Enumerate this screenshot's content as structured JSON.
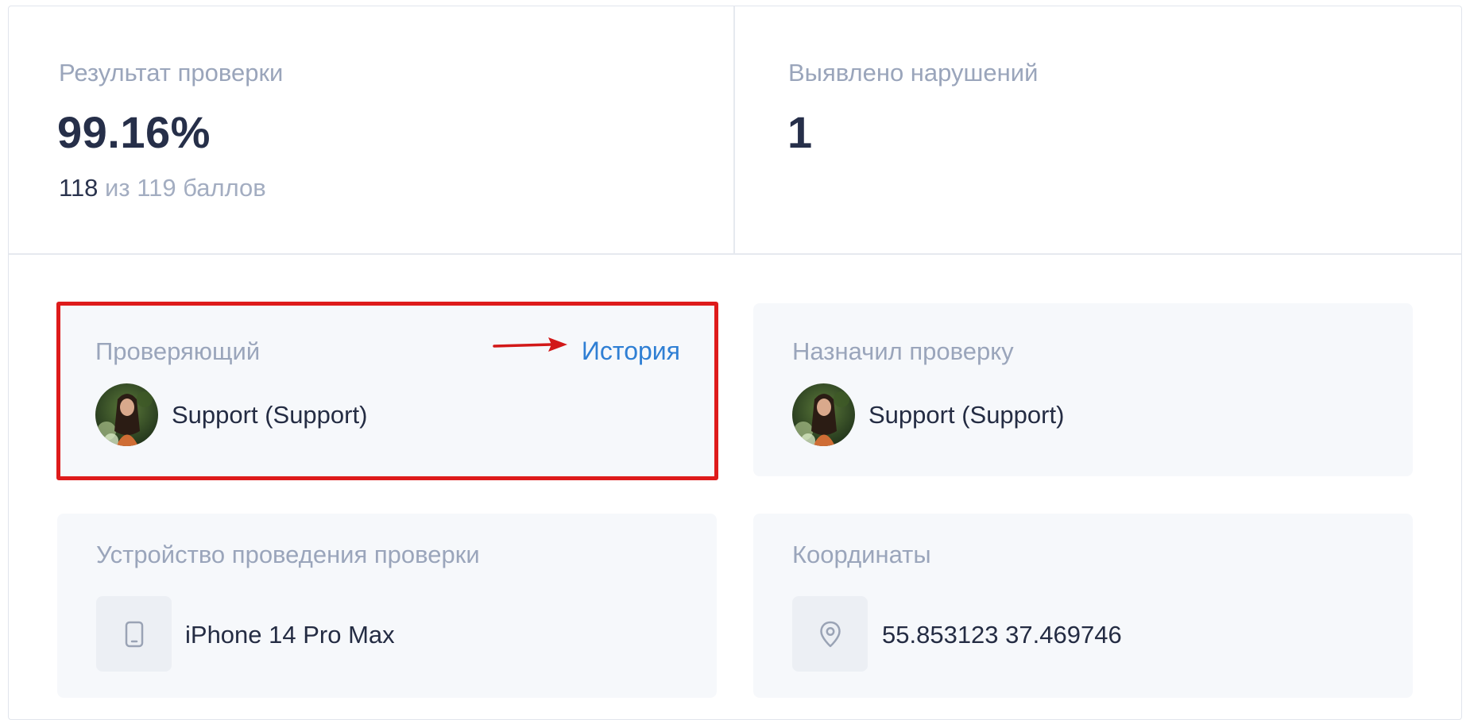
{
  "stats": {
    "result": {
      "label": "Результат проверки",
      "value": "99.16%",
      "score_current": "118",
      "score_rest": "из 119 баллов"
    },
    "violations": {
      "label": "Выявлено нарушений",
      "value": "1"
    }
  },
  "cards": {
    "inspector": {
      "title": "Проверяющий",
      "link": "История",
      "name": "Support (Support)",
      "highlighted": true,
      "highlight_color": "#de1b1b"
    },
    "assigned": {
      "title": "Назначил проверку",
      "name": "Support (Support)"
    },
    "device": {
      "title": "Устройство проведения проверки",
      "icon": "phone-icon",
      "value": "iPhone 14 Pro Max"
    },
    "coordinates": {
      "title": "Координаты",
      "icon": "location-pin-icon",
      "value": "55.853123 37.469746"
    }
  },
  "colors": {
    "label": "#9aa5bb",
    "text": "#242c43",
    "link": "#2f7fd4",
    "card_bg": "#f6f8fb"
  }
}
